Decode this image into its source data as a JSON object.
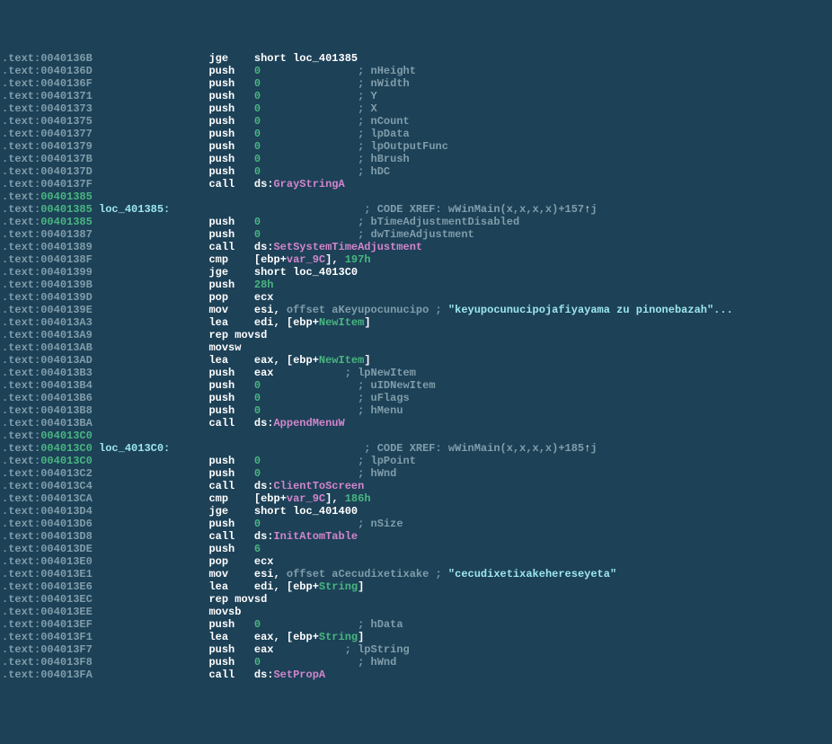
{
  "lines": [
    {
      "addr": "0040136B",
      "gray": true,
      "mnem": "jge    ",
      "ops": [
        {
          "t": "short loc_401385",
          "c": "op-white"
        }
      ]
    },
    {
      "addr": "0040136D",
      "gray": true,
      "mnem": "push   ",
      "ops": [
        {
          "t": "0",
          "c": "op-green"
        }
      ],
      "cmtPad": 16,
      "cmt": "nHeight"
    },
    {
      "addr": "0040136F",
      "gray": true,
      "mnem": "push   ",
      "ops": [
        {
          "t": "0",
          "c": "op-green"
        }
      ],
      "cmtPad": 16,
      "cmt": "nWidth"
    },
    {
      "addr": "00401371",
      "gray": true,
      "mnem": "push   ",
      "ops": [
        {
          "t": "0",
          "c": "op-green"
        }
      ],
      "cmtPad": 16,
      "cmt": "Y"
    },
    {
      "addr": "00401373",
      "gray": true,
      "mnem": "push   ",
      "ops": [
        {
          "t": "0",
          "c": "op-green"
        }
      ],
      "cmtPad": 16,
      "cmt": "X"
    },
    {
      "addr": "00401375",
      "gray": true,
      "mnem": "push   ",
      "ops": [
        {
          "t": "0",
          "c": "op-green"
        }
      ],
      "cmtPad": 16,
      "cmt": "nCount"
    },
    {
      "addr": "00401377",
      "gray": true,
      "mnem": "push   ",
      "ops": [
        {
          "t": "0",
          "c": "op-green"
        }
      ],
      "cmtPad": 16,
      "cmt": "lpData"
    },
    {
      "addr": "00401379",
      "gray": true,
      "mnem": "push   ",
      "ops": [
        {
          "t": "0",
          "c": "op-green"
        }
      ],
      "cmtPad": 16,
      "cmt": "lpOutputFunc"
    },
    {
      "addr": "0040137B",
      "gray": true,
      "mnem": "push   ",
      "ops": [
        {
          "t": "0",
          "c": "op-green"
        }
      ],
      "cmtPad": 16,
      "cmt": "hBrush"
    },
    {
      "addr": "0040137D",
      "gray": true,
      "mnem": "push   ",
      "ops": [
        {
          "t": "0",
          "c": "op-green"
        }
      ],
      "cmtPad": 16,
      "cmt": "hDC"
    },
    {
      "addr": "0040137F",
      "gray": true,
      "mnem": "call   ",
      "ops": [
        {
          "t": "ds",
          "c": "op-white"
        },
        {
          "t": ":",
          "c": "op-white"
        },
        {
          "t": "GrayStringA",
          "c": "op-pink"
        }
      ]
    },
    {
      "addr": "00401385",
      "gray": false
    },
    {
      "addr": "00401385",
      "gray": false,
      "label": "loc_401385:",
      "xrefPad": 30,
      "xref": "CODE XREF: wWinMain(x,x,x,x)+157",
      "arrow": "↑",
      "xsuffix": "j"
    },
    {
      "addr": "00401385",
      "gray": false,
      "mnem": "push   ",
      "ops": [
        {
          "t": "0",
          "c": "op-green"
        }
      ],
      "cmtPad": 16,
      "cmt": "bTimeAdjustmentDisabled"
    },
    {
      "addr": "00401387",
      "gray": true,
      "mnem": "push   ",
      "ops": [
        {
          "t": "0",
          "c": "op-green"
        }
      ],
      "cmtPad": 16,
      "cmt": "dwTimeAdjustment"
    },
    {
      "addr": "00401389",
      "gray": true,
      "mnem": "call   ",
      "ops": [
        {
          "t": "ds",
          "c": "op-white"
        },
        {
          "t": ":",
          "c": "op-white"
        },
        {
          "t": "SetSystemTimeAdjustment",
          "c": "op-pink"
        }
      ]
    },
    {
      "addr": "0040138F",
      "gray": true,
      "mnem": "cmp    ",
      "ops": [
        {
          "t": "[",
          "c": "brace"
        },
        {
          "t": "ebp",
          "c": "op-white"
        },
        {
          "t": "+",
          "c": "op-white"
        },
        {
          "t": "var_9C",
          "c": "op-pink"
        },
        {
          "t": "]",
          "c": "brace"
        },
        {
          "t": ", ",
          "c": "op-white"
        },
        {
          "t": "197h",
          "c": "op-green"
        }
      ]
    },
    {
      "addr": "00401399",
      "gray": true,
      "mnem": "jge    ",
      "ops": [
        {
          "t": "short loc_4013C0",
          "c": "op-white"
        }
      ]
    },
    {
      "addr": "0040139B",
      "gray": true,
      "mnem": "push   ",
      "ops": [
        {
          "t": "28h",
          "c": "op-green"
        }
      ]
    },
    {
      "addr": "0040139D",
      "gray": true,
      "mnem": "pop    ",
      "ops": [
        {
          "t": "ecx",
          "c": "op-white"
        }
      ]
    },
    {
      "addr": "0040139E",
      "gray": true,
      "mnem": "mov    ",
      "ops": [
        {
          "t": "esi",
          "c": "op-white"
        },
        {
          "t": ", ",
          "c": "op-white"
        },
        {
          "t": "offset aKeyupocunucipo ; ",
          "c": "cmt"
        },
        {
          "t": "\"keyupocunucipojafiyayama zu pinonebazah\"...",
          "c": "cmt-cyan"
        }
      ]
    },
    {
      "addr": "004013A3",
      "gray": true,
      "mnem": "lea    ",
      "ops": [
        {
          "t": "edi",
          "c": "op-white"
        },
        {
          "t": ", ",
          "c": "op-white"
        },
        {
          "t": "[",
          "c": "brace"
        },
        {
          "t": "ebp",
          "c": "op-white"
        },
        {
          "t": "+",
          "c": "op-white"
        },
        {
          "t": "NewItem",
          "c": "op-green"
        },
        {
          "t": "]",
          "c": "brace"
        }
      ]
    },
    {
      "addr": "004013A9",
      "gray": true,
      "mnem": "rep movsd",
      "ops": []
    },
    {
      "addr": "004013AB",
      "gray": true,
      "mnem": "movsw",
      "ops": []
    },
    {
      "addr": "004013AD",
      "gray": true,
      "mnem": "lea    ",
      "ops": [
        {
          "t": "eax",
          "c": "op-white"
        },
        {
          "t": ", ",
          "c": "op-white"
        },
        {
          "t": "[",
          "c": "brace"
        },
        {
          "t": "ebp",
          "c": "op-white"
        },
        {
          "t": "+",
          "c": "op-white"
        },
        {
          "t": "NewItem",
          "c": "op-green"
        },
        {
          "t": "]",
          "c": "brace"
        }
      ]
    },
    {
      "addr": "004013B3",
      "gray": true,
      "mnem": "push   ",
      "ops": [
        {
          "t": "eax",
          "c": "op-white"
        }
      ],
      "cmtPad": 14,
      "cmt": "lpNewItem"
    },
    {
      "addr": "004013B4",
      "gray": true,
      "mnem": "push   ",
      "ops": [
        {
          "t": "0",
          "c": "op-green"
        }
      ],
      "cmtPad": 16,
      "cmt": "uIDNewItem"
    },
    {
      "addr": "004013B6",
      "gray": true,
      "mnem": "push   ",
      "ops": [
        {
          "t": "0",
          "c": "op-green"
        }
      ],
      "cmtPad": 16,
      "cmt": "uFlags"
    },
    {
      "addr": "004013B8",
      "gray": true,
      "mnem": "push   ",
      "ops": [
        {
          "t": "0",
          "c": "op-green"
        }
      ],
      "cmtPad": 16,
      "cmt": "hMenu"
    },
    {
      "addr": "004013BA",
      "gray": true,
      "mnem": "call   ",
      "ops": [
        {
          "t": "ds",
          "c": "op-white"
        },
        {
          "t": ":",
          "c": "op-white"
        },
        {
          "t": "AppendMenuW",
          "c": "op-pink"
        }
      ]
    },
    {
      "addr": "004013C0",
      "gray": false
    },
    {
      "addr": "004013C0",
      "gray": false,
      "label": "loc_4013C0:",
      "xrefPad": 30,
      "xref": "CODE XREF: wWinMain(x,x,x,x)+185",
      "arrow": "↑",
      "xsuffix": "j"
    },
    {
      "addr": "004013C0",
      "gray": false,
      "mnem": "push   ",
      "ops": [
        {
          "t": "0",
          "c": "op-green"
        }
      ],
      "cmtPad": 16,
      "cmt": "lpPoint"
    },
    {
      "addr": "004013C2",
      "gray": true,
      "mnem": "push   ",
      "ops": [
        {
          "t": "0",
          "c": "op-green"
        }
      ],
      "cmtPad": 16,
      "cmt": "hWnd"
    },
    {
      "addr": "004013C4",
      "gray": true,
      "mnem": "call   ",
      "ops": [
        {
          "t": "ds",
          "c": "op-white"
        },
        {
          "t": ":",
          "c": "op-white"
        },
        {
          "t": "ClientToScreen",
          "c": "op-pink"
        }
      ]
    },
    {
      "addr": "004013CA",
      "gray": true,
      "mnem": "cmp    ",
      "ops": [
        {
          "t": "[",
          "c": "brace"
        },
        {
          "t": "ebp",
          "c": "op-white"
        },
        {
          "t": "+",
          "c": "op-white"
        },
        {
          "t": "var_9C",
          "c": "op-pink"
        },
        {
          "t": "]",
          "c": "brace"
        },
        {
          "t": ", ",
          "c": "op-white"
        },
        {
          "t": "186h",
          "c": "op-green"
        }
      ]
    },
    {
      "addr": "004013D4",
      "gray": true,
      "mnem": "jge    ",
      "ops": [
        {
          "t": "short loc_401400",
          "c": "op-white"
        }
      ]
    },
    {
      "addr": "004013D6",
      "gray": true,
      "mnem": "push   ",
      "ops": [
        {
          "t": "0",
          "c": "op-green"
        }
      ],
      "cmtPad": 16,
      "cmt": "nSize"
    },
    {
      "addr": "004013D8",
      "gray": true,
      "mnem": "call   ",
      "ops": [
        {
          "t": "ds",
          "c": "op-white"
        },
        {
          "t": ":",
          "c": "op-white"
        },
        {
          "t": "InitAtomTable",
          "c": "op-pink"
        }
      ]
    },
    {
      "addr": "004013DE",
      "gray": true,
      "mnem": "push   ",
      "ops": [
        {
          "t": "6",
          "c": "op-green"
        }
      ]
    },
    {
      "addr": "004013E0",
      "gray": true,
      "mnem": "pop    ",
      "ops": [
        {
          "t": "ecx",
          "c": "op-white"
        }
      ]
    },
    {
      "addr": "004013E1",
      "gray": true,
      "mnem": "mov    ",
      "ops": [
        {
          "t": "esi",
          "c": "op-white"
        },
        {
          "t": ", ",
          "c": "op-white"
        },
        {
          "t": "offset aCecudixetixake ; ",
          "c": "cmt"
        },
        {
          "t": "\"cecudixetixakehereseyeta\"",
          "c": "cmt-cyan"
        }
      ]
    },
    {
      "addr": "004013E6",
      "gray": true,
      "mnem": "lea    ",
      "ops": [
        {
          "t": "edi",
          "c": "op-white"
        },
        {
          "t": ", ",
          "c": "op-white"
        },
        {
          "t": "[",
          "c": "brace"
        },
        {
          "t": "ebp",
          "c": "op-white"
        },
        {
          "t": "+",
          "c": "op-white"
        },
        {
          "t": "String",
          "c": "op-green"
        },
        {
          "t": "]",
          "c": "brace"
        }
      ]
    },
    {
      "addr": "004013EC",
      "gray": true,
      "mnem": "rep movsd",
      "ops": []
    },
    {
      "addr": "004013EE",
      "gray": true,
      "mnem": "movsb",
      "ops": []
    },
    {
      "addr": "004013EF",
      "gray": true,
      "mnem": "push   ",
      "ops": [
        {
          "t": "0",
          "c": "op-green"
        }
      ],
      "cmtPad": 16,
      "cmt": "hData"
    },
    {
      "addr": "004013F1",
      "gray": true,
      "mnem": "lea    ",
      "ops": [
        {
          "t": "eax",
          "c": "op-white"
        },
        {
          "t": ", ",
          "c": "op-white"
        },
        {
          "t": "[",
          "c": "brace"
        },
        {
          "t": "ebp",
          "c": "op-white"
        },
        {
          "t": "+",
          "c": "op-white"
        },
        {
          "t": "String",
          "c": "op-green"
        },
        {
          "t": "]",
          "c": "brace"
        }
      ]
    },
    {
      "addr": "004013F7",
      "gray": true,
      "mnem": "push   ",
      "ops": [
        {
          "t": "eax",
          "c": "op-white"
        }
      ],
      "cmtPad": 14,
      "cmt": "lpString"
    },
    {
      "addr": "004013F8",
      "gray": true,
      "mnem": "push   ",
      "ops": [
        {
          "t": "0",
          "c": "op-green"
        }
      ],
      "cmtPad": 16,
      "cmt": "hWnd"
    },
    {
      "addr": "004013FA",
      "gray": true,
      "mnem": "call   ",
      "ops": [
        {
          "t": "ds",
          "c": "op-white"
        },
        {
          "t": ":",
          "c": "op-white"
        },
        {
          "t": "SetPropA",
          "c": "op-pink"
        }
      ]
    }
  ],
  "seg": ".text",
  "mnemCol": 18,
  "opCol": 7
}
